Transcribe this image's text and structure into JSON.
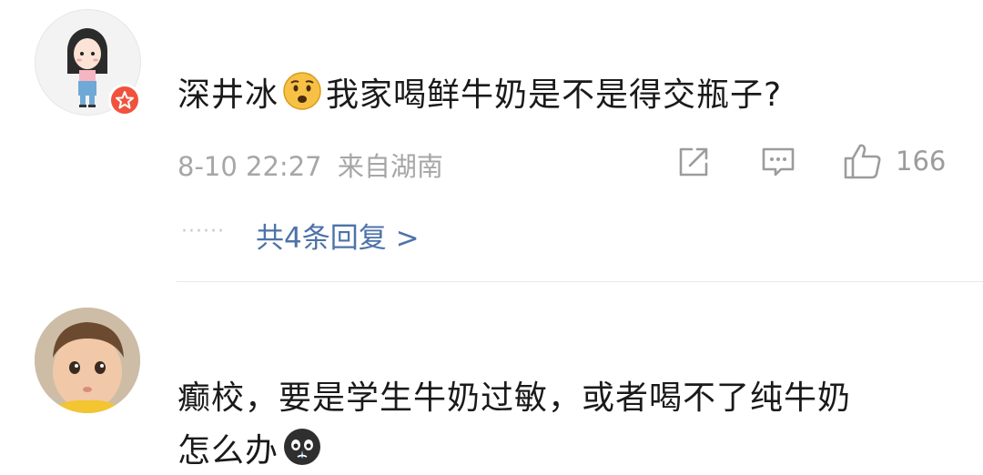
{
  "comments": [
    {
      "avatar": "girl-avatar",
      "badge": "vip-badge",
      "text_before_emoji": "深井冰",
      "emoji": "worried-face-emoji",
      "text_after_emoji": "我家喝鲜牛奶是不是得交瓶子?",
      "timestamp": "8-10 22:27",
      "location": "来自湖南",
      "like_count": "166",
      "replies_dots": "······",
      "replies_label": "共4条回复 >"
    },
    {
      "avatar": "toddler-avatar",
      "line1": "癫校，要是学生牛奶过敏，或者喝不了纯牛奶",
      "line2": "怎么办",
      "emoji": "crying-face-emoji"
    }
  ],
  "colors": {
    "link_blue": "#4d73a8",
    "meta_gray": "#a6a6a6",
    "badge_red": "#f0523c"
  }
}
